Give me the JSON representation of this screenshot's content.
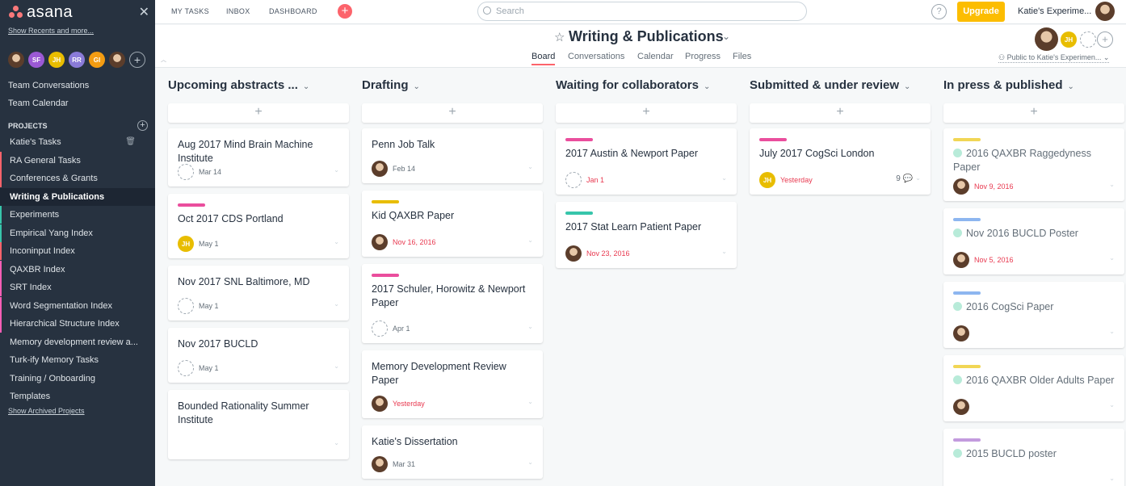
{
  "colors": {
    "accent": "#fc636b",
    "sidebar_bg": "#273240",
    "upgrade": "#fcbd01",
    "overdue": "#e8384f"
  },
  "sidebar": {
    "logo": "asana",
    "show_recents": "Show Recents and more...",
    "team_initials": [
      "SF",
      "JH",
      "RR",
      "GI"
    ],
    "team_conversations": "Team Conversations",
    "team_calendar": "Team Calendar",
    "projects_heading": "PROJECTS",
    "projects": [
      {
        "label": "Katie's Tasks",
        "color": "transparent"
      },
      {
        "label": "RA General Tasks",
        "color": "#fc636b"
      },
      {
        "label": "Conferences & Grants",
        "color": "#fc636b"
      },
      {
        "label": "Writing & Publications",
        "color": "#1d2633"
      },
      {
        "label": "Experiments",
        "color": "#37c5ab"
      },
      {
        "label": "Empirical Yang Index",
        "color": "#37c5ab"
      },
      {
        "label": "Inconinput Index",
        "color": "#fc636b"
      },
      {
        "label": "QAXBR Index",
        "color": "#f95eb6"
      },
      {
        "label": "SRT Index",
        "color": "#f95eb6"
      },
      {
        "label": "Word Segmentation Index",
        "color": "#f95eb6"
      },
      {
        "label": "Hierarchical Structure Index",
        "color": "#f95eb6"
      },
      {
        "label": "Memory development review a...",
        "color": "transparent"
      },
      {
        "label": "Turk-ify Memory Tasks",
        "color": "transparent"
      },
      {
        "label": "Training / Onboarding",
        "color": "transparent"
      },
      {
        "label": "Templates",
        "color": "transparent"
      }
    ],
    "show_archived": "Show Archived Projects"
  },
  "topbar": {
    "my_tasks": "MY TASKS",
    "inbox": "INBOX",
    "dashboard": "DASHBOARD",
    "search_placeholder": "Search",
    "help": "?",
    "upgrade": "Upgrade",
    "account": "Katie's Experime..."
  },
  "project": {
    "title": "Writing & Publications",
    "tabs": [
      "Board",
      "Conversations",
      "Calendar",
      "Progress",
      "Files"
    ],
    "active_tab": "Board",
    "member_initials": "JH",
    "privacy": "Public to Katie's Experimen..."
  },
  "board": {
    "columns": [
      {
        "title": "Upcoming abstracts ...",
        "cards": [
          {
            "name": "Aug 2017 Mind Brain Machine Institute",
            "assignee": "ghost",
            "due": "Mar 14",
            "overdue": false,
            "tag": null
          },
          {
            "name": "Oct 2017 CDS Portland",
            "assignee": "JH",
            "due": "May 1",
            "overdue": false,
            "tag": "#ea4e9d"
          },
          {
            "name": "Nov 2017 SNL Baltimore, MD",
            "assignee": "ghost",
            "due": "May 1",
            "overdue": false,
            "tag": null
          },
          {
            "name": "Nov 2017 BUCLD",
            "assignee": "ghost",
            "due": "May 1",
            "overdue": false,
            "tag": null
          },
          {
            "name": "Bounded Rationality Summer Institute",
            "assignee": null,
            "due": "",
            "overdue": false,
            "tag": null
          }
        ]
      },
      {
        "title": "Drafting",
        "cards": [
          {
            "name": "Penn Job Talk",
            "assignee": "photo",
            "due": "Feb 14",
            "overdue": false,
            "tag": null
          },
          {
            "name": "Kid QAXBR Paper",
            "assignee": "photo",
            "due": "Nov 16, 2016",
            "overdue": true,
            "tag": "#e8bd00"
          },
          {
            "name": "2017 Schuler, Horowitz & Newport Paper",
            "assignee": "ghost",
            "due": "Apr 1",
            "overdue": false,
            "tag": "#ea4e9d"
          },
          {
            "name": "Memory Development Review Paper",
            "assignee": "photo",
            "due": "Yesterday",
            "overdue": true,
            "tag": null
          },
          {
            "name": "Katie's Dissertation",
            "assignee": "photo",
            "due": "Mar 31",
            "overdue": false,
            "tag": null
          }
        ]
      },
      {
        "title": "Waiting for collaborators",
        "cards": [
          {
            "name": "2017 Austin & Newport Paper",
            "assignee": "ghost",
            "due": "Jan 1",
            "overdue": true,
            "tag": "#ea4e9d"
          },
          {
            "name": "2017 Stat Learn Patient Paper",
            "assignee": "photo",
            "due": "Nov 23, 2016",
            "overdue": true,
            "tag": "#37c5ab"
          }
        ]
      },
      {
        "title": "Submitted & under review",
        "cards": [
          {
            "name": "July 2017 CogSci London",
            "assignee": "JH",
            "due": "Yesterday",
            "overdue": true,
            "tag": "#ea4e9d",
            "comments": "9"
          }
        ]
      },
      {
        "title": "In press & published",
        "cards": [
          {
            "name": "2016 QAXBR Raggedyness Paper",
            "assignee": "photo",
            "due": "Nov 9, 2016",
            "overdue": true,
            "tag": "#f1d655",
            "done": true
          },
          {
            "name": "Nov 2016 BUCLD Poster",
            "assignee": "photo",
            "due": "Nov 5, 2016",
            "overdue": true,
            "tag": "#8db6f0",
            "done": true
          },
          {
            "name": "2016 CogSci Paper",
            "assignee": "photo",
            "due": "",
            "overdue": false,
            "tag": "#8db6f0",
            "done": true
          },
          {
            "name": "2016 QAXBR Older Adults Paper",
            "assignee": "photo",
            "due": "",
            "overdue": false,
            "tag": "#f1d655",
            "done": true
          },
          {
            "name": "2015 BUCLD poster",
            "assignee": null,
            "due": "",
            "overdue": false,
            "tag": "#c39bde",
            "done": true
          }
        ]
      }
    ]
  }
}
